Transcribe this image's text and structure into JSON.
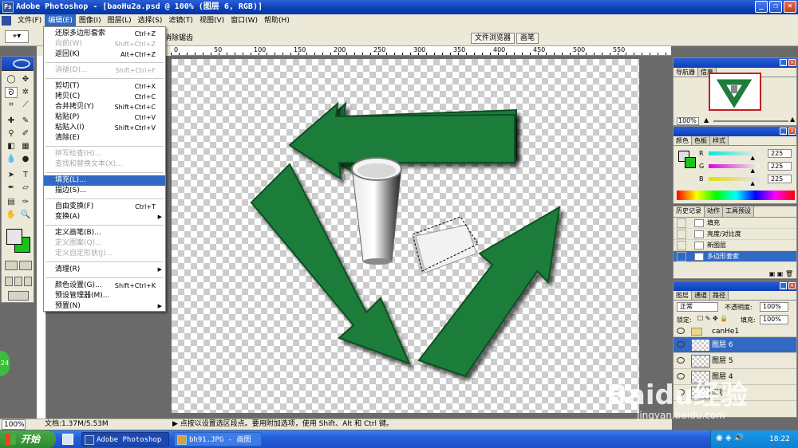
{
  "window": {
    "title": "Adobe Photoshop - [baoHu2a.psd @ 100% (图层 6, RGB)]",
    "app_icon": "photoshop-icon",
    "minimize": "_",
    "restore": "❐",
    "close": "×"
  },
  "menubar": {
    "items": [
      "文件(F)",
      "编辑(E)",
      "图像(I)",
      "图层(L)",
      "选择(S)",
      "滤镜(T)",
      "视图(V)",
      "窗口(W)",
      "帮助(H)"
    ],
    "active": 1
  },
  "options": {
    "label": "消除锯齿"
  },
  "palette_well": {
    "items": [
      "文件浏览器",
      "画笔"
    ]
  },
  "edit_menu": {
    "groups": [
      [
        {
          "label": "还原多边形套索",
          "shortcut": "Ctrl+Z",
          "disabled": false
        },
        {
          "label": "向前(W)",
          "shortcut": "Shift+Ctrl+Z",
          "disabled": true
        },
        {
          "label": "返回(K)",
          "shortcut": "Alt+Ctrl+Z",
          "disabled": false
        }
      ],
      [
        {
          "label": "消褪(D)...",
          "shortcut": "Shift+Ctrl+F",
          "disabled": true
        }
      ],
      [
        {
          "label": "剪切(T)",
          "shortcut": "Ctrl+X",
          "disabled": false
        },
        {
          "label": "拷贝(C)",
          "shortcut": "Ctrl+C",
          "disabled": false
        },
        {
          "label": "合并拷贝(Y)",
          "shortcut": "Shift+Ctrl+C",
          "disabled": false
        },
        {
          "label": "粘贴(P)",
          "shortcut": "Ctrl+V",
          "disabled": false
        },
        {
          "label": "粘贴入(I)",
          "shortcut": "Shift+Ctrl+V",
          "disabled": false
        },
        {
          "label": "清除(E)",
          "shortcut": "",
          "disabled": false
        }
      ],
      [
        {
          "label": "拼写检查(H)...",
          "shortcut": "",
          "disabled": true
        },
        {
          "label": "查找和替换文本(X)...",
          "shortcut": "",
          "disabled": true
        }
      ],
      [
        {
          "label": "填充(L)...",
          "shortcut": "",
          "disabled": false,
          "selected": true
        },
        {
          "label": "描边(S)...",
          "shortcut": "",
          "disabled": false
        }
      ],
      [
        {
          "label": "自由变换(F)",
          "shortcut": "Ctrl+T",
          "disabled": false
        },
        {
          "label": "变换(A)",
          "shortcut": "",
          "disabled": false,
          "submenu": true
        }
      ],
      [
        {
          "label": "定义画笔(B)...",
          "shortcut": "",
          "disabled": false
        },
        {
          "label": "定义图案(Q)...",
          "shortcut": "",
          "disabled": true
        },
        {
          "label": "定义自定形状(J)...",
          "shortcut": "",
          "disabled": true
        }
      ],
      [
        {
          "label": "清理(R)",
          "shortcut": "",
          "disabled": false,
          "submenu": true
        }
      ],
      [
        {
          "label": "颜色设置(G)...",
          "shortcut": "Shift+Ctrl+K",
          "disabled": false
        },
        {
          "label": "预设管理器(M)...",
          "shortcut": "",
          "disabled": false
        },
        {
          "label": "预置(N)",
          "shortcut": "",
          "disabled": false,
          "submenu": true
        }
      ]
    ]
  },
  "ruler": {
    "labels": [
      "0",
      "50",
      "100",
      "150",
      "200",
      "250",
      "300",
      "350",
      "400",
      "450",
      "500",
      "550"
    ]
  },
  "canvas": {
    "arrow_color": "#1c7a3a",
    "arrow_edge": "#0f4f22"
  },
  "statusbar": {
    "zoom": "100%",
    "doc": "文档:1.37M/5.53M",
    "hint": "▶ 点按以设置选区段点。要用附加选项，使用 Shift、Alt 和 Ctrl 键。"
  },
  "navigator": {
    "tabs": [
      "导航器",
      "信息"
    ],
    "zoom": "100%"
  },
  "color_panel": {
    "tabs": [
      "颜色",
      "色板",
      "样式"
    ],
    "channels": [
      {
        "name": "R",
        "value": "225",
        "bar": "linear-gradient(to right,#00e8e1,#ffe8e1)",
        "level": 0.882
      },
      {
        "name": "G",
        "value": "225",
        "bar": "linear-gradient(to right,#e100e1,#e1ffe1)",
        "level": 0.882
      },
      {
        "name": "B",
        "value": "225",
        "bar": "linear-gradient(to right,#e1e100,#e1e1ff)",
        "level": 0.882
      }
    ],
    "fg": "#e1e1e1",
    "bg": "#18c418"
  },
  "history_panel": {
    "tabs": [
      "历史记录",
      "动作",
      "工具预设"
    ],
    "items": [
      {
        "label": "填充",
        "active": false
      },
      {
        "label": "亮度/对比度",
        "active": false
      },
      {
        "label": "新图层",
        "active": false
      },
      {
        "label": "多边形套索",
        "active": true
      }
    ]
  },
  "layers_panel": {
    "tabs": [
      "图层",
      "通道",
      "路径"
    ],
    "blend_mode": "正常",
    "opacity_label": "不透明度:",
    "opacity": "100%",
    "lock_label": "锁定:",
    "fill_label": "填充:",
    "fill": "100%",
    "layers": [
      {
        "name": "canHe1",
        "group": true,
        "active": false
      },
      {
        "name": "图层 6",
        "group": false,
        "active": true
      },
      {
        "name": "图层 5",
        "group": false,
        "active": false
      },
      {
        "name": "图层 4",
        "group": false,
        "active": false
      },
      {
        "name": "形状",
        "group": false,
        "active": false
      }
    ]
  },
  "taskbar": {
    "start": "开始",
    "items": [
      "Adobe Photoshop ...",
      "bh91.JPG - 画图"
    ],
    "clock": "18:22"
  },
  "side_badge": "24",
  "watermark": {
    "text": "Baidu经验",
    "url": "jingyan.baidu.com"
  }
}
